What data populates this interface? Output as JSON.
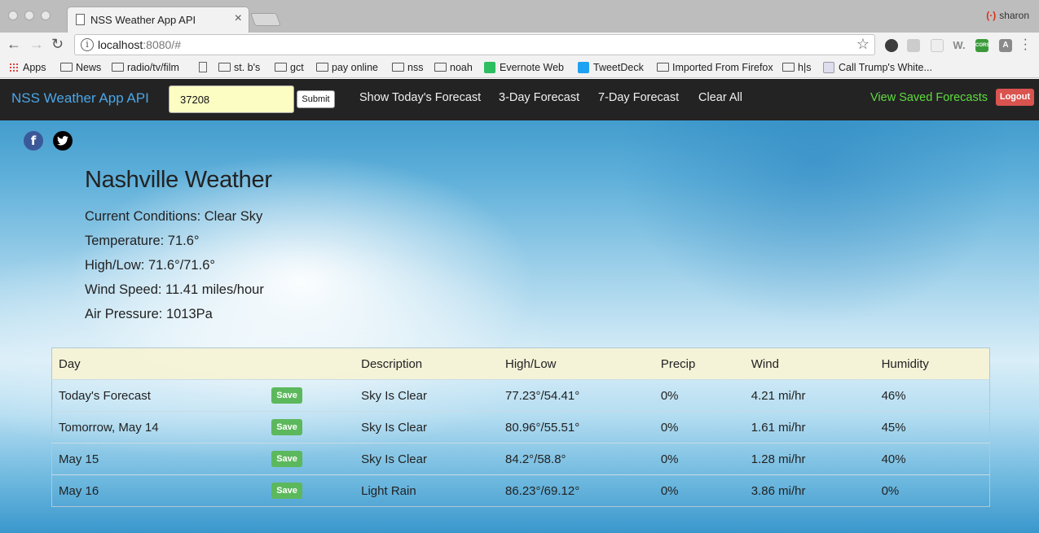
{
  "browser": {
    "tab_title": "NSS Weather App API",
    "tab_close": "×",
    "profile_name": "sharon",
    "url_host": "localhost",
    "url_rest": ":8080/#",
    "bookmarks": [
      {
        "label": "Apps"
      },
      {
        "label": "News"
      },
      {
        "label": "radio/tv/film"
      },
      {
        "label": ""
      },
      {
        "label": "st. b's"
      },
      {
        "label": "gct"
      },
      {
        "label": "pay online"
      },
      {
        "label": "nss"
      },
      {
        "label": "noah"
      },
      {
        "label": "Evernote Web"
      },
      {
        "label": "TweetDeck"
      },
      {
        "label": "Imported From Firefox"
      },
      {
        "label": "h|s"
      },
      {
        "label": "Call Trump's White..."
      }
    ]
  },
  "navbar": {
    "brand": "NSS Weather App API",
    "zip_value": "37208",
    "submit_label": "Submit",
    "links": [
      "Show Today's Forecast",
      "3-Day Forecast",
      "7-Day Forecast",
      "Clear All"
    ],
    "saved_label": "View Saved Forecasts",
    "logout_label": "Logout"
  },
  "social": {
    "facebook": "f",
    "twitter": "t"
  },
  "current": {
    "city_title": "Nashville Weather",
    "conditions": "Current Conditions: Clear Sky",
    "temperature": "Temperature: 71.6°",
    "high_low": "High/Low: 71.6°/71.6°",
    "wind": "Wind Speed: 11.41 miles/hour",
    "pressure": "Air Pressure: 1013Pa"
  },
  "table": {
    "headers": [
      "Day",
      "Description",
      "High/Low",
      "Precip",
      "Wind",
      "Humidity"
    ],
    "save_label": "Save",
    "rows": [
      {
        "day": "Today's Forecast",
        "description": "Sky Is Clear",
        "high_low": "77.23°/54.41°",
        "precip": "0%",
        "wind": "4.21 mi/hr",
        "humidity": "46%"
      },
      {
        "day": "Tomorrow, May 14",
        "description": "Sky Is Clear",
        "high_low": "80.96°/55.51°",
        "precip": "0%",
        "wind": "1.61 mi/hr",
        "humidity": "45%"
      },
      {
        "day": "May 15",
        "description": "Sky Is Clear",
        "high_low": "84.2°/58.8°",
        "precip": "0%",
        "wind": "1.28 mi/hr",
        "humidity": "40%"
      },
      {
        "day": "May 16",
        "description": "Light Rain",
        "high_low": "86.23°/69.12°",
        "precip": "0%",
        "wind": "3.86 mi/hr",
        "humidity": "0%"
      }
    ]
  }
}
